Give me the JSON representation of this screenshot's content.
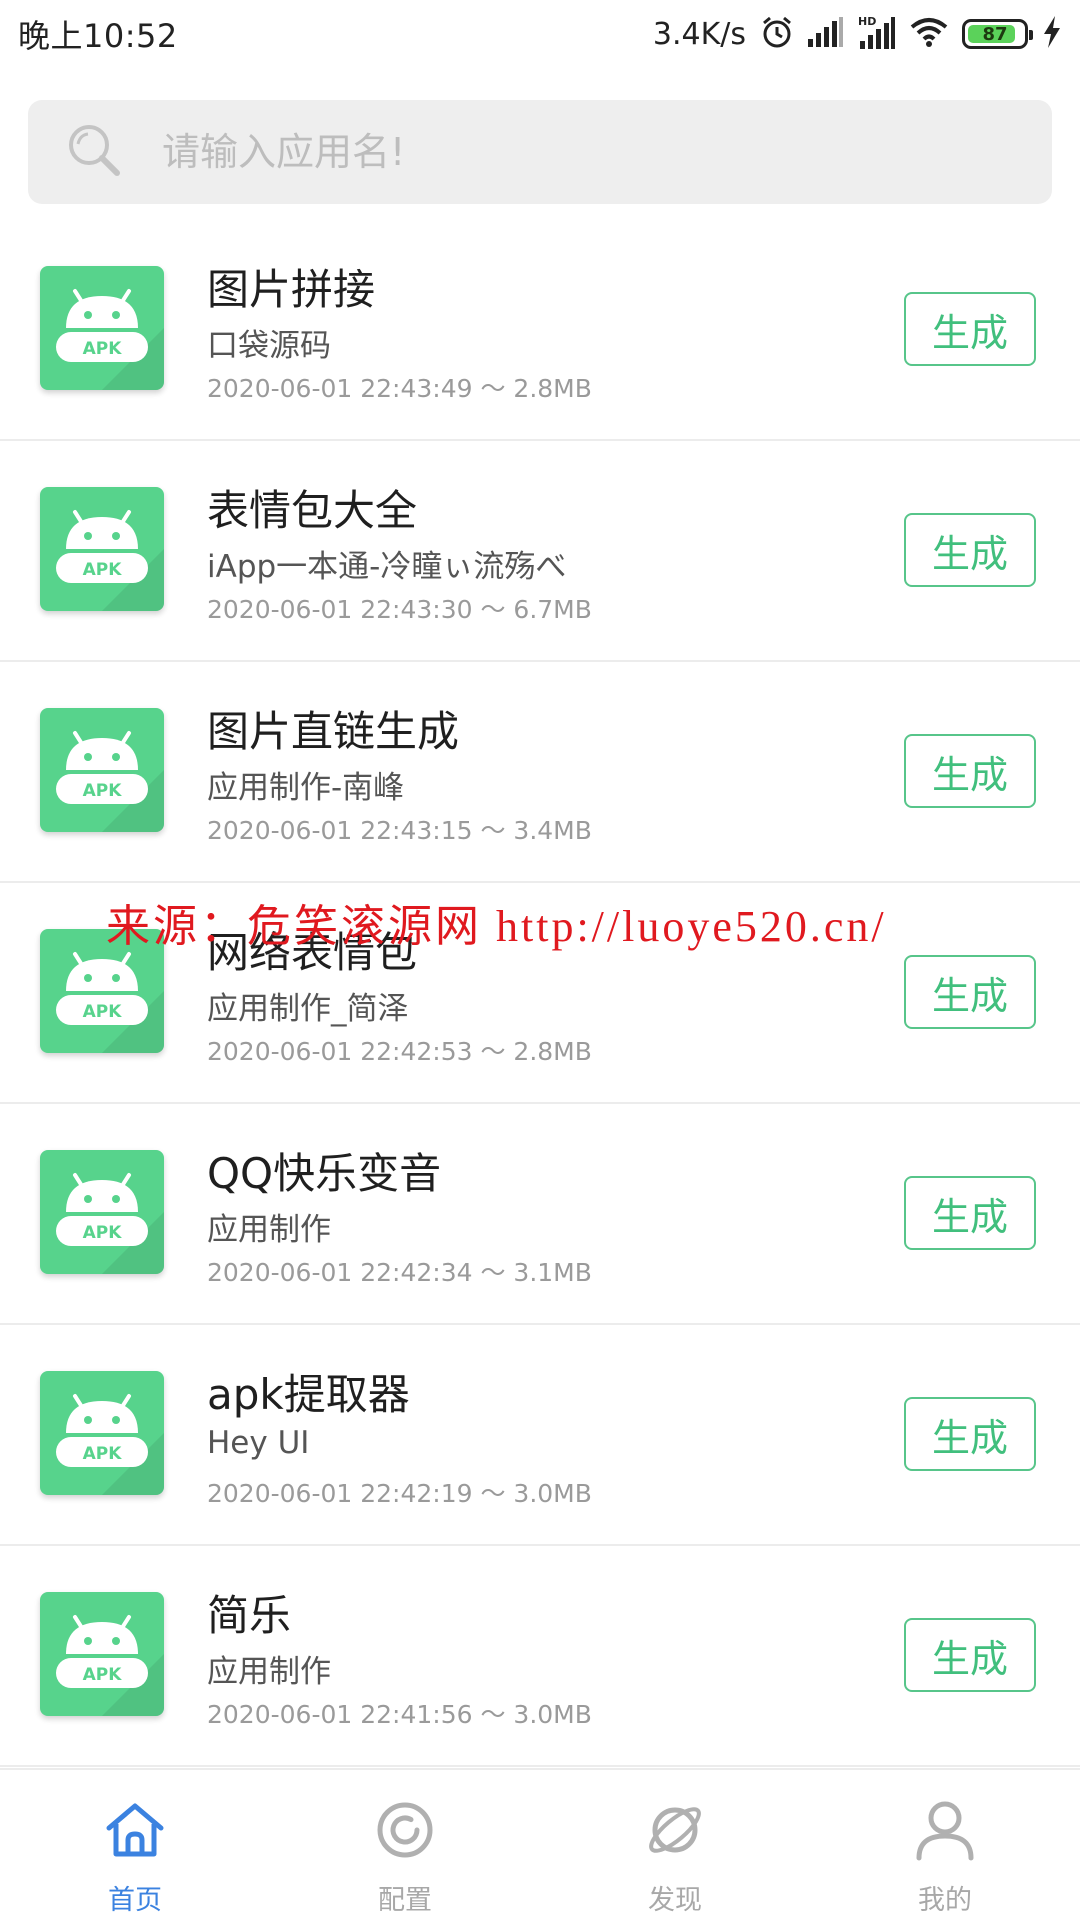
{
  "status_bar": {
    "time": "晚上10:52",
    "net_speed": "3.4K/s",
    "battery": "87",
    "battery_level": 0.87
  },
  "search": {
    "placeholder": "请输入应用名!"
  },
  "icon": {
    "badge_label": "APK",
    "color": "#57d38c"
  },
  "apps": [
    {
      "title": "图片拼接",
      "author": "口袋源码",
      "meta": "2020-06-01 22:43:49 ～ 2.8MB",
      "button": "生成"
    },
    {
      "title": "表情包大全",
      "author": "iApp一本通-冷瞳ぃ流殇べ",
      "meta": "2020-06-01 22:43:30 ～ 6.7MB",
      "button": "生成"
    },
    {
      "title": "图片直链生成",
      "author": "应用制作-南峰",
      "meta": "2020-06-01 22:43:15 ～ 3.4MB",
      "button": "生成"
    },
    {
      "title": "网络表情包",
      "author": "应用制作_简泽",
      "meta": "2020-06-01 22:42:53 ～ 2.8MB",
      "button": "生成"
    },
    {
      "title": "QQ快乐变音",
      "author": "应用制作",
      "meta": "2020-06-01 22:42:34 ～ 3.1MB",
      "button": "生成"
    },
    {
      "title": "apk提取器",
      "author": "Hey UI",
      "meta": "2020-06-01 22:42:19 ～ 3.0MB",
      "button": "生成"
    },
    {
      "title": "简乐",
      "author": "应用制作",
      "meta": "2020-06-01 22:41:56 ～ 3.0MB",
      "button": "生成"
    }
  ],
  "watermark": "来源：危笑滚源网  http://luoye520.cn/",
  "bottom_nav": [
    {
      "label": "首页",
      "icon": "home-icon",
      "active": true
    },
    {
      "label": "配置",
      "icon": "config-icon",
      "active": false
    },
    {
      "label": "发现",
      "icon": "planet-icon",
      "active": false
    },
    {
      "label": "我的",
      "icon": "user-icon",
      "active": false
    }
  ],
  "colors": {
    "accent_green": "#41bf7d",
    "nav_active": "#3b82e0",
    "nav_inactive": "#a8a8a8",
    "watermark_red": "#e0191f"
  }
}
